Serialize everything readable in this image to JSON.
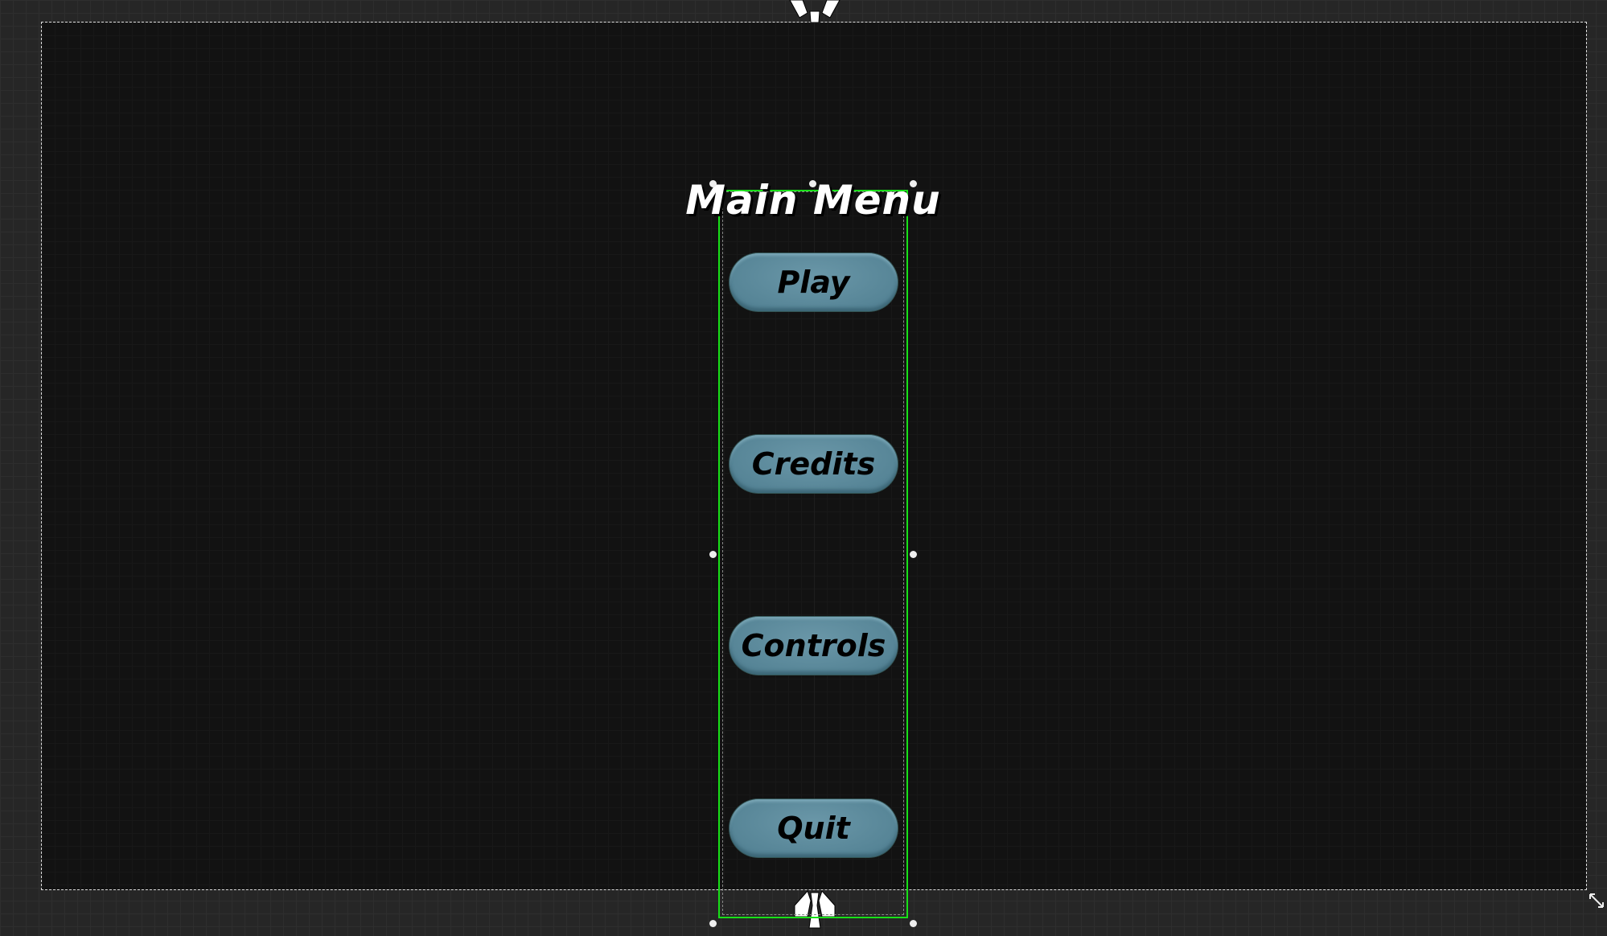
{
  "title": "Main Menu",
  "buttons": [
    {
      "label": "Play"
    },
    {
      "label": "Credits"
    },
    {
      "label": "Controls"
    },
    {
      "label": "Quit"
    }
  ],
  "colors": {
    "selection": "#18e018",
    "button": "#5f8c9d",
    "canvas": "#121212"
  }
}
